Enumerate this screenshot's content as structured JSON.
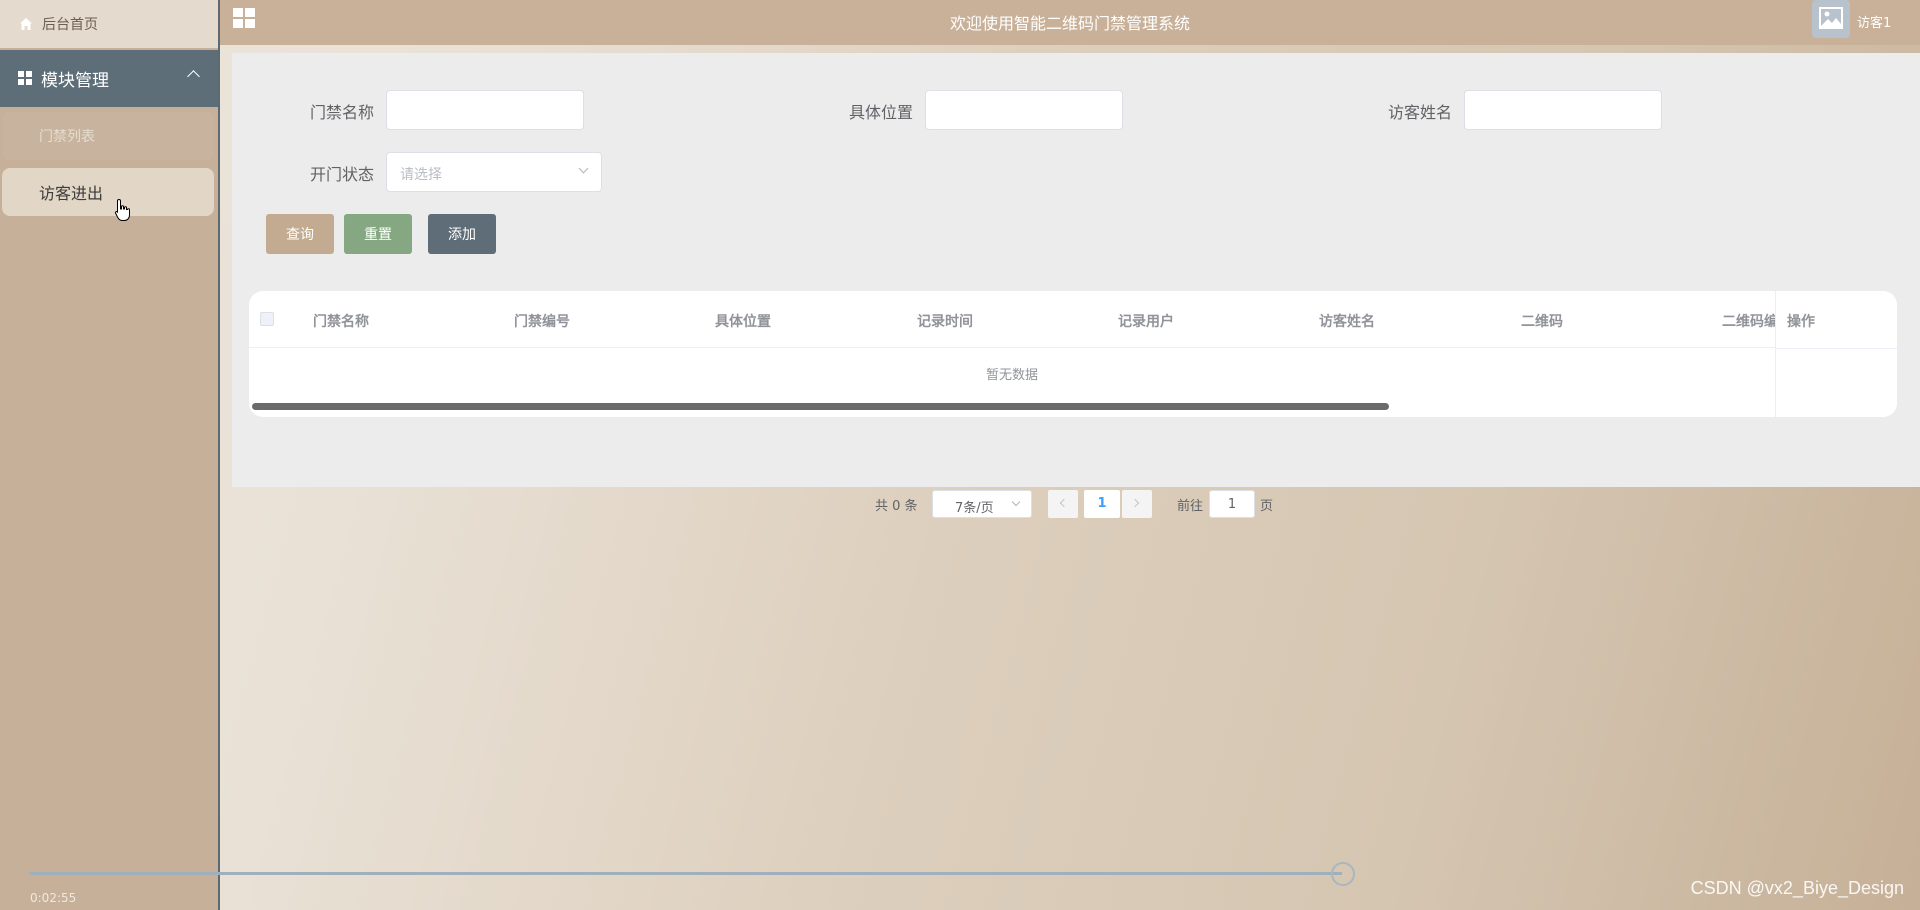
{
  "header": {
    "title": "欢迎使用智能二维码门禁管理系统",
    "username": "访客1"
  },
  "sidebar": {
    "home": "后台首页",
    "module": "模块管理",
    "items": [
      {
        "label": "门禁列表",
        "active": true
      },
      {
        "label": "访客进出",
        "active": false
      }
    ]
  },
  "search": {
    "fields": [
      {
        "label": "门禁名称",
        "value": ""
      },
      {
        "label": "具体位置",
        "value": ""
      },
      {
        "label": "访客姓名",
        "value": ""
      }
    ],
    "status": {
      "label": "开门状态",
      "placeholder": "请选择"
    },
    "buttons": {
      "query": "查询",
      "reset": "重置",
      "add": "添加"
    }
  },
  "table": {
    "columns": [
      "门禁名称",
      "门禁编号",
      "具体位置",
      "记录时间",
      "记录用户",
      "访客姓名",
      "二维码",
      "二维码编"
    ],
    "action_column": "操作",
    "empty_text": "暂无数据",
    "rows": []
  },
  "pagination": {
    "total": "共 0 条",
    "page_size": "7条/页",
    "current_page": "1",
    "goto_label": "前往",
    "goto_value": "1",
    "page_suffix": "页"
  },
  "video": {
    "elapsed": "0:02:55",
    "progress": 0.82
  },
  "watermark": "CSDN @vx2_Biye_Design",
  "colors": {
    "topbar": "#c9b199",
    "sidebar_active_module": "#5d6e78",
    "btn_query": "#c3ab91",
    "btn_reset": "#85a883",
    "btn_add": "#5e6d77"
  }
}
